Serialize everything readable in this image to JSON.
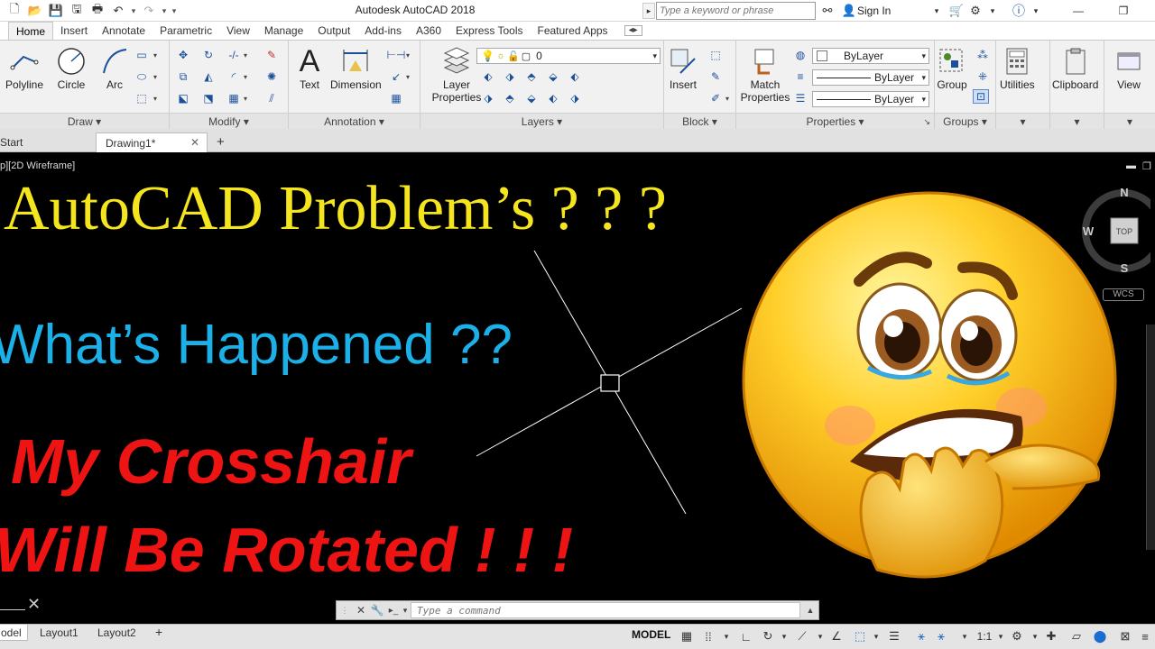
{
  "titlebar": {
    "app_title": "Autodesk AutoCAD 2018",
    "search_placeholder": "Type a keyword or phrase",
    "sign_in": "Sign In"
  },
  "ribbon_tabs": [
    "Home",
    "Insert",
    "Annotate",
    "Parametric",
    "View",
    "Manage",
    "Output",
    "Add-ins",
    "A360",
    "Express Tools",
    "Featured Apps"
  ],
  "ribbon_tab_extra": "◂▸",
  "panels": {
    "draw": {
      "title": "Draw",
      "buttons": [
        "Polyline",
        "Circle",
        "Arc"
      ]
    },
    "modify": {
      "title": "Modify"
    },
    "annotation": {
      "title": "Annotation",
      "buttons": [
        "Text",
        "Dimension"
      ]
    },
    "layers": {
      "title": "Layers",
      "layer_properties": "Layer Properties",
      "current_layer": "0"
    },
    "block": {
      "title": "Block",
      "insert": "Insert"
    },
    "properties": {
      "title": "Properties",
      "match_properties": "Match Properties",
      "color": "ByLayer",
      "linetype": "ByLayer",
      "lineweight": "ByLayer"
    },
    "groups": {
      "title": "Groups",
      "group": "Group"
    },
    "utilities": "Utilities",
    "clipboard": "Clipboard",
    "view": "View"
  },
  "file_tabs": {
    "start": "Start",
    "drawing": "Drawing1*"
  },
  "viewport": {
    "label": "p][2D Wireframe]",
    "line1": "AutoCAD Problem’s ? ? ?",
    "line2": "What’s Happened ??",
    "line3": "My Crosshair",
    "line4": "Will Be Rotated ! ! !",
    "viewcube": {
      "n": "N",
      "w": "W",
      "s": "S",
      "top": "TOP",
      "wcs": "WCS"
    },
    "command_placeholder": "Type a command"
  },
  "statusbar": {
    "layouts": [
      "odel",
      "Layout1",
      "Layout2"
    ],
    "model": "MODEL",
    "scale": "1:1"
  }
}
